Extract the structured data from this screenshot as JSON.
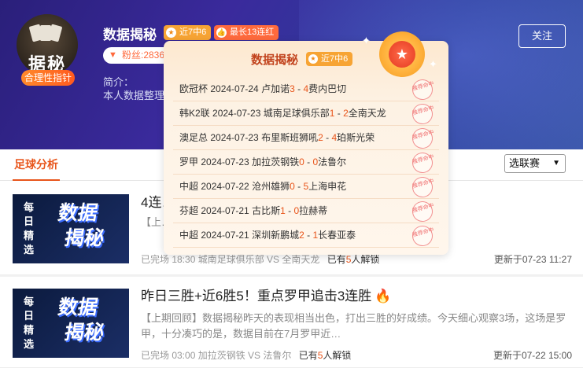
{
  "header": {
    "avatar_text": "据秘",
    "rational_badge": "合理性指针",
    "name": "数据揭秘",
    "tag_recent": "近7中6",
    "tag_streak": "最长13连红",
    "fans": "粉丝:2836",
    "intro_label": "简介：",
    "intro_text": "本人数据整理… …行业领域，对风险管…",
    "follow_label": "关注"
  },
  "tabbar": {
    "tab_football": "足球分析",
    "league_select": "选联赛"
  },
  "articles": [
    {
      "thumb_side": "每日精选",
      "thumb_big1": "数据",
      "thumb_big2": "揭秘",
      "title": "4连…",
      "summary": "【上… …的好成绩，目前是4连胜标识 +近8…",
      "meta_status": "已完场 18:30 城南足球俱乐部 VS 全南天龙",
      "unlock_prefix": "已有",
      "unlock_count": "5",
      "unlock_suffix": "人解锁",
      "updated": "更新于07-23 11:27"
    },
    {
      "thumb_side": "每日精选",
      "thumb_big1": "数据",
      "thumb_big2": "揭秘",
      "title": "昨日三胜+近6胜5！重点罗甲追击3连胜",
      "fire_icon": "fire-icon",
      "summary": "【上期回顾】数据揭秘昨天的表现相当出色，打出三胜的好成绩。今天细心观察3场，这场是罗甲，十分凑巧的是，数据目前在7月罗甲近…",
      "meta_status": "已完场 03:00 加拉茨钢铁 VS 法鲁尔",
      "unlock_prefix": "已有",
      "unlock_count": "5",
      "unlock_suffix": "人解锁",
      "updated": "更新于07-22 15:00"
    }
  ],
  "popup": {
    "title": "数据揭秘",
    "tag": "近7中6",
    "stamp_text": "推荐命中",
    "rows": [
      {
        "league": "欧冠杯",
        "date": "2024-07-24",
        "home": "卢加诺",
        "hs": "3",
        "as": "4",
        "away": "费内巴切"
      },
      {
        "league": "韩K2联",
        "date": "2024-07-23",
        "home": "城南足球俱乐部",
        "hs": "1",
        "as": "2",
        "away": "全南天龙"
      },
      {
        "league": "澳足总",
        "date": "2024-07-23",
        "home": "布里斯班狮吼",
        "hs": "2",
        "as": "4",
        "away": "珀斯光荣"
      },
      {
        "league": "罗甲",
        "date": "2024-07-23",
        "home": "加拉茨钢铁",
        "hs": "0",
        "as": "0",
        "away": "法鲁尔"
      },
      {
        "league": "中超",
        "date": "2024-07-22",
        "home": "沧州雄狮",
        "hs": "0",
        "as": "5",
        "away": "上海申花"
      },
      {
        "league": "芬超",
        "date": "2024-07-21",
        "home": "古比斯",
        "hs": "1",
        "as": "0",
        "away": "拉赫蒂"
      },
      {
        "league": "中超",
        "date": "2024-07-21",
        "home": "深圳新鹏城",
        "hs": "2",
        "as": "1",
        "away": "长春亚泰"
      }
    ]
  }
}
